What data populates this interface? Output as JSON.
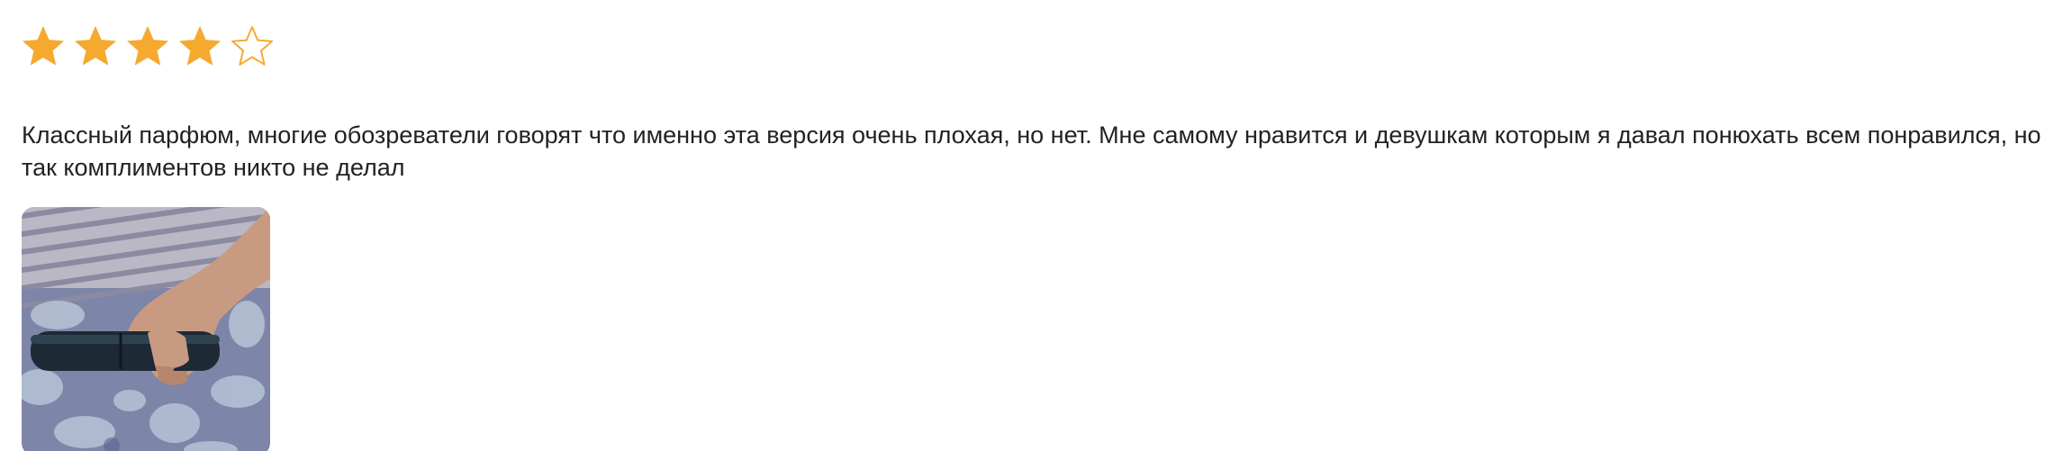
{
  "review": {
    "rating": 4,
    "max_rating": 5,
    "star_color": "#F5AA2F",
    "text": "Классный парфюм, многие обозреватели говорят что именно эта версия очень плохая, но нет. Мне самому нравится и девушкам которым я давал понюхать всем понравился, но так комплиментов никто не делал",
    "photos": [
      {
        "icon": "review-photo"
      }
    ]
  }
}
